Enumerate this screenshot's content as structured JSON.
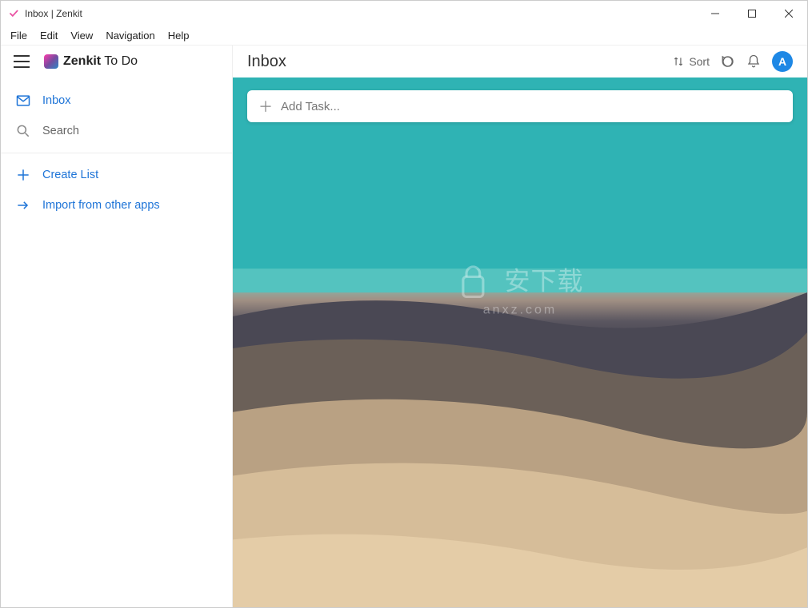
{
  "window": {
    "title": "Inbox | Zenkit"
  },
  "menubar": {
    "items": [
      "File",
      "Edit",
      "View",
      "Navigation",
      "Help"
    ]
  },
  "sidebar": {
    "brand_bold": "Zenkit",
    "brand_rest": " To Do",
    "nav": [
      {
        "label": "Inbox",
        "icon": "mail",
        "active": true
      },
      {
        "label": "Search",
        "icon": "search",
        "active": false
      }
    ],
    "actions": [
      {
        "label": "Create List",
        "icon": "plus"
      },
      {
        "label": "Import from other apps",
        "icon": "arrow-right"
      }
    ]
  },
  "main": {
    "title": "Inbox",
    "sort_label": "Sort",
    "avatar_letter": "A",
    "add_task_placeholder": "Add Task..."
  },
  "watermark": {
    "line1": "安下载",
    "line2": "anxz.com"
  }
}
